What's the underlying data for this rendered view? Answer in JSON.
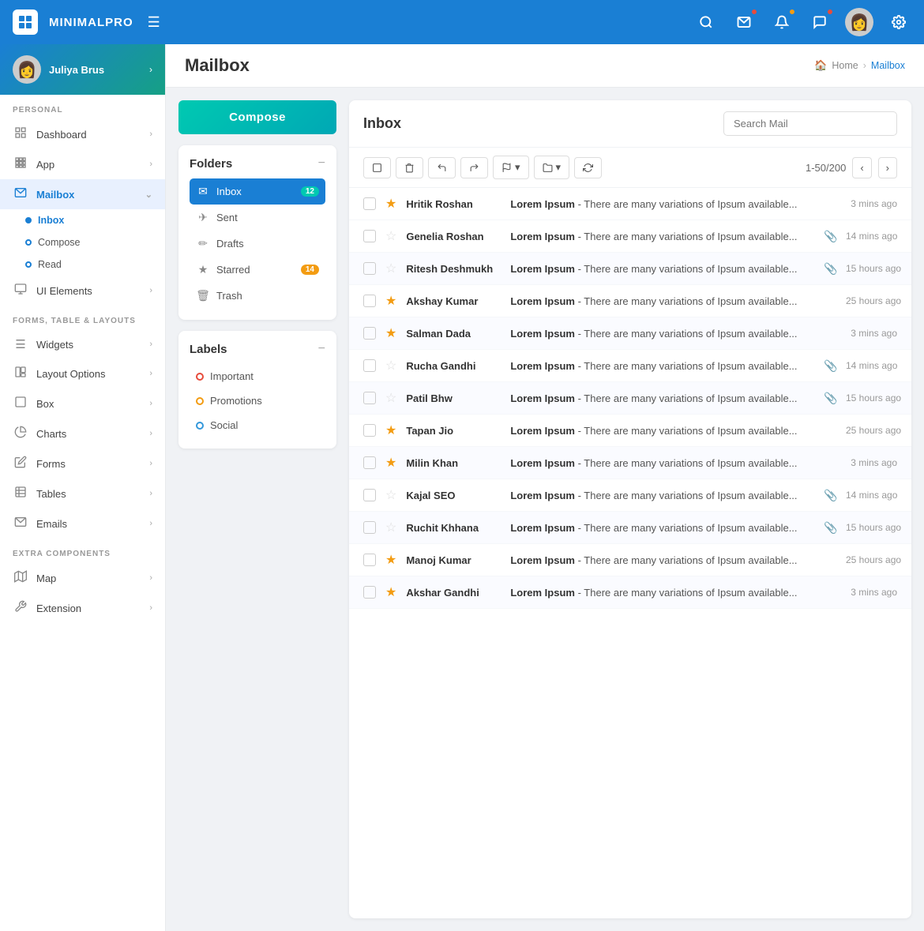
{
  "app": {
    "name": "MINIMALPRO",
    "logo_alt": "MP"
  },
  "topnav": {
    "hamburger": "☰",
    "icons": [
      "search",
      "mail",
      "bell",
      "chat",
      "gear"
    ],
    "user_avatar": "👩"
  },
  "sidebar": {
    "user": {
      "name": "Juliya Brus",
      "arrow": "›"
    },
    "personal_label": "PERSONAL",
    "personal_items": [
      {
        "icon": "🎨",
        "label": "Dashboard",
        "arrow": "›"
      },
      {
        "icon": "⊞",
        "label": "App",
        "arrow": "›"
      },
      {
        "icon": "✉",
        "label": "Mailbox",
        "arrow": "›",
        "active": true
      }
    ],
    "mailbox_subitems": [
      {
        "label": "Inbox",
        "active": true
      },
      {
        "label": "Compose"
      },
      {
        "label": "Read"
      }
    ],
    "ui_item": {
      "icon": "🖥",
      "label": "UI Elements",
      "arrow": "›"
    },
    "forms_label": "FORMS, TABLE & LAYOUTS",
    "forms_items": [
      {
        "icon": "☰",
        "label": "Widgets",
        "arrow": "›"
      },
      {
        "icon": "⧉",
        "label": "Layout Options",
        "arrow": "›"
      },
      {
        "icon": "▢",
        "label": "Box",
        "arrow": "›"
      },
      {
        "icon": "◑",
        "label": "Charts",
        "arrow": "›"
      },
      {
        "icon": "✏",
        "label": "Forms",
        "arrow": "›"
      },
      {
        "icon": "⊞",
        "label": "Tables",
        "arrow": "›"
      },
      {
        "icon": "✉",
        "label": "Emails",
        "arrow": "›"
      }
    ],
    "extra_label": "EXTRA COMPONENTS",
    "extra_items": [
      {
        "icon": "🗺",
        "label": "Map",
        "arrow": "›"
      },
      {
        "icon": "🔧",
        "label": "Extension",
        "arrow": "›"
      }
    ]
  },
  "page": {
    "title": "Mailbox",
    "breadcrumb_home": "Home",
    "breadcrumb_current": "Mailbox"
  },
  "compose_btn": "Compose",
  "folders": {
    "title": "Folders",
    "items": [
      {
        "icon": "✉",
        "label": "Inbox",
        "badge": "12",
        "badge_color": "teal",
        "active": true
      },
      {
        "icon": "✈",
        "label": "Sent"
      },
      {
        "icon": "✏",
        "label": "Drafts"
      },
      {
        "icon": "★",
        "label": "Starred",
        "badge": "14",
        "badge_color": "orange"
      },
      {
        "icon": "🗑",
        "label": "Trash"
      }
    ]
  },
  "labels": {
    "title": "Labels",
    "items": [
      {
        "color": "red",
        "label": "Important"
      },
      {
        "color": "orange",
        "label": "Promotions"
      },
      {
        "color": "blue",
        "label": "Social"
      }
    ]
  },
  "inbox": {
    "title": "Inbox",
    "search_placeholder": "Search Mail",
    "toolbar": {
      "pagination": "1-50/200"
    },
    "emails": [
      {
        "sender": "Hritik Roshan",
        "subject": "Lorem Ipsum",
        "preview": " - There are many variations of Ipsum available...",
        "time": "3 mins ago",
        "starred": true,
        "attach": false,
        "highlighted": false
      },
      {
        "sender": "Genelia Roshan",
        "subject": "Lorem Ipsum",
        "preview": " - There are many variations of Ipsum available...",
        "time": "14 mins ago",
        "starred": false,
        "attach": true,
        "highlighted": false
      },
      {
        "sender": "Ritesh Deshmukh",
        "subject": "Lorem Ipsum",
        "preview": " - There are many variations of Ipsum available...",
        "time": "15 hours ago",
        "starred": false,
        "attach": true,
        "highlighted": true
      },
      {
        "sender": "Akshay Kumar",
        "subject": "Lorem Ipsum",
        "preview": " - There are many variations of Ipsum available...",
        "time": "25 hours ago",
        "starred": true,
        "attach": false,
        "highlighted": false
      },
      {
        "sender": "Salman Dada",
        "subject": "Lorem Ipsum",
        "preview": " - There are many variations of Ipsum available...",
        "time": "3 mins ago",
        "starred": true,
        "attach": false,
        "highlighted": true
      },
      {
        "sender": "Rucha Gandhi",
        "subject": "Lorem Ipsum",
        "preview": " - There are many variations of Ipsum available...",
        "time": "14 mins ago",
        "starred": false,
        "attach": true,
        "highlighted": false
      },
      {
        "sender": "Patil Bhw",
        "subject": "Lorem Ipsum",
        "preview": " - There are many variations of Ipsum available...",
        "time": "15 hours ago",
        "starred": false,
        "attach": true,
        "highlighted": true
      },
      {
        "sender": "Tapan Jio",
        "subject": "Lorem Ipsum",
        "preview": " - There are many variations of Ipsum available...",
        "time": "25 hours ago",
        "starred": true,
        "attach": false,
        "highlighted": false
      },
      {
        "sender": "Milin Khan",
        "subject": "Lorem Ipsum",
        "preview": " - There are many variations of Ipsum available...",
        "time": "3 mins ago",
        "starred": true,
        "attach": false,
        "highlighted": true
      },
      {
        "sender": "Kajal SEO",
        "subject": "Lorem Ipsum",
        "preview": " - There are many variations of Ipsum available...",
        "time": "14 mins ago",
        "starred": false,
        "attach": true,
        "highlighted": false
      },
      {
        "sender": "Ruchit Khhana",
        "subject": "Lorem Ipsum",
        "preview": " - There are many variations of Ipsum available...",
        "time": "15 hours ago",
        "starred": false,
        "attach": true,
        "highlighted": true
      },
      {
        "sender": "Manoj Kumar",
        "subject": "Lorem Ipsum",
        "preview": " - There are many variations of Ipsum available...",
        "time": "25 hours ago",
        "starred": true,
        "attach": false,
        "highlighted": false
      },
      {
        "sender": "Akshar Gandhi",
        "subject": "Lorem Ipsum",
        "preview": " - There are many variations of Ipsum available...",
        "time": "3 mins ago",
        "starred": true,
        "attach": false,
        "highlighted": true
      }
    ]
  }
}
